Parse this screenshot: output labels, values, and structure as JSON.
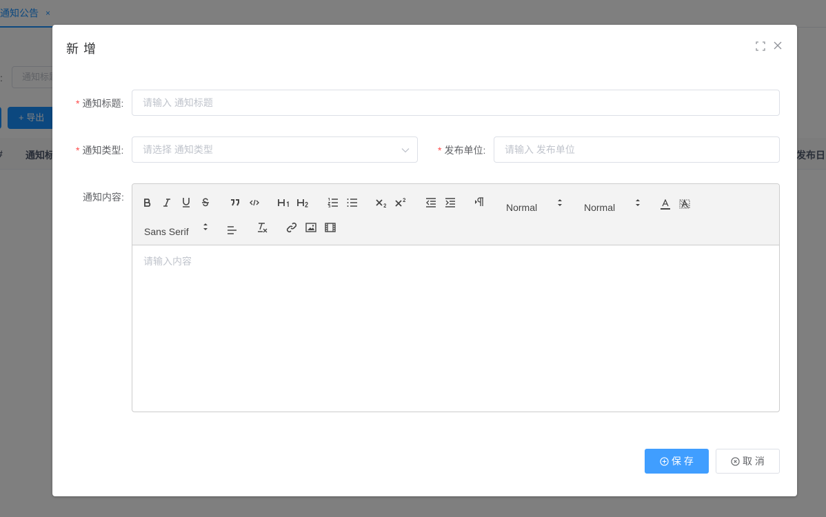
{
  "page": {
    "tab_label": "通知公告",
    "tab_close": "×",
    "search_label_fragment": "题:",
    "search_input_fragment": "通知标题",
    "export_button": "+ 导出",
    "table_headers": {
      "index": "#",
      "title": "通知标",
      "date": "发布日"
    }
  },
  "dialog": {
    "title": "新 增",
    "icons": {
      "maximize": "maximize-icon",
      "close": "close-icon"
    },
    "form": {
      "title": {
        "label": "通知标题:",
        "placeholder": "请输入 通知标题",
        "required": true
      },
      "type": {
        "label": "通知类型:",
        "placeholder": "请选择 通知类型",
        "required": true
      },
      "unit": {
        "label": "发布单位:",
        "placeholder": "请输入 发布单位",
        "required": true
      },
      "content": {
        "label": "通知内容:",
        "placeholder": "请输入内容",
        "required": false
      }
    },
    "editor": {
      "header_picker": "Normal",
      "size_picker": "Normal",
      "font_picker": "Sans Serif",
      "toolbar_icons": [
        "bold-icon",
        "italic-icon",
        "underline-icon",
        "strike-icon",
        "blockquote-icon",
        "code-block-icon",
        "header-1-icon",
        "header-2-icon",
        "ordered-list-icon",
        "bullet-list-icon",
        "subscript-icon",
        "superscript-icon",
        "outdent-icon",
        "indent-icon",
        "rtl-direction-icon",
        "text-color-icon",
        "background-color-icon",
        "align-icon",
        "clear-format-icon",
        "link-icon",
        "image-icon",
        "video-icon"
      ]
    },
    "buttons": {
      "save": "保 存",
      "cancel": "取 消"
    },
    "colors": {
      "primary": "#409eff",
      "required": "#ff4949",
      "overlay": "rgba(0,0,0,0.5)"
    }
  }
}
